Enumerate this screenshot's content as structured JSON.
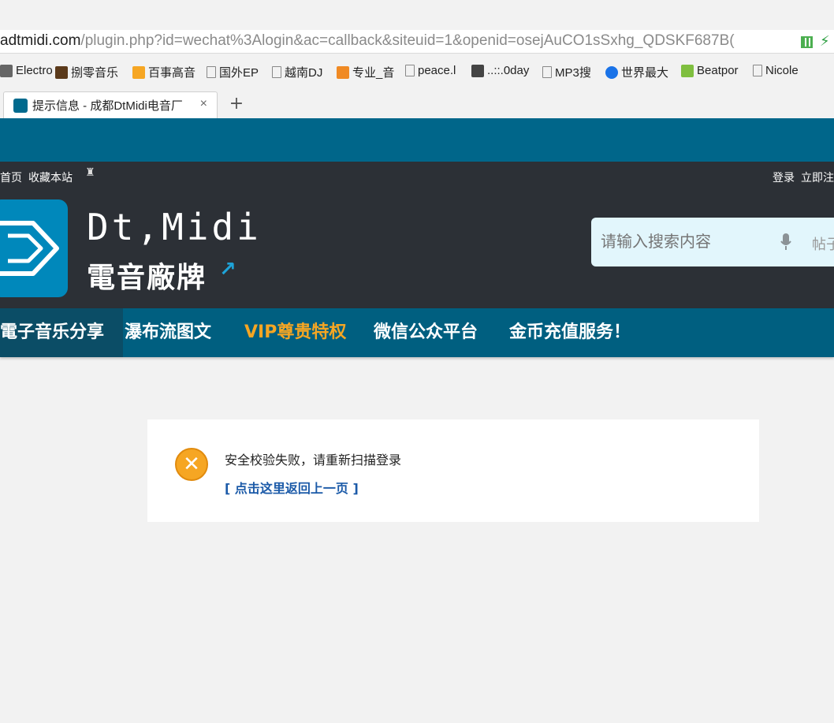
{
  "browser": {
    "url_host": "adtmidi.com",
    "url_path": "/plugin.php?id=wechat%3Alogin&ac=callback&siteuid=1&openid=osejAuCO1sSxhg_QDSKF687B(",
    "bookmarks": [
      {
        "label": "Electro",
        "icon": "music-icon"
      },
      {
        "label": "捌零音乐",
        "icon": "eighty-icon"
      },
      {
        "label": "百事高音",
        "icon": "leaf-icon"
      },
      {
        "label": "国外EP",
        "icon": "page-icon"
      },
      {
        "label": "越南DJ",
        "icon": "page-icon"
      },
      {
        "label": "专业_音",
        "icon": "badge-2-icon"
      },
      {
        "label": "peace.l",
        "icon": "page-icon"
      },
      {
        "label": "..::.0day",
        "icon": "headphones-icon"
      },
      {
        "label": "MP3搜",
        "icon": "page-icon"
      },
      {
        "label": "世界最大",
        "icon": "blue-dot-icon"
      },
      {
        "label": "Beatpor",
        "icon": "beatport-icon"
      },
      {
        "label": "Nicole",
        "icon": "page-icon"
      }
    ],
    "tab_title": "提示信息 - 成都DtMidi电音厂",
    "tab_close": "×",
    "new_tab": "+"
  },
  "site": {
    "top_links": [
      "首页",
      "收藏本站"
    ],
    "user_links": [
      "登录",
      "立即注"
    ],
    "logo_title": "Dt,Midi",
    "logo_sub": "電音廠牌",
    "search_placeholder": "请输入搜索内容",
    "search_type": "帖子",
    "nav": [
      {
        "label": "電子音乐分享",
        "active": true
      },
      {
        "label": "瀑布流图文"
      },
      {
        "label": "VIP尊贵特权",
        "vip": true
      },
      {
        "label": "微信公众平台"
      },
      {
        "label": "金币充值服务！"
      }
    ]
  },
  "message": {
    "text": "安全校验失败，请重新扫描登录",
    "link": "[ 点击这里返回上一页 ]"
  },
  "colors": {
    "teal": "#00668a",
    "header_dark": "#2c3036",
    "nav": "#005f80",
    "vip": "#f6a623",
    "error": "#f6a623",
    "link": "#1b5aa8"
  }
}
